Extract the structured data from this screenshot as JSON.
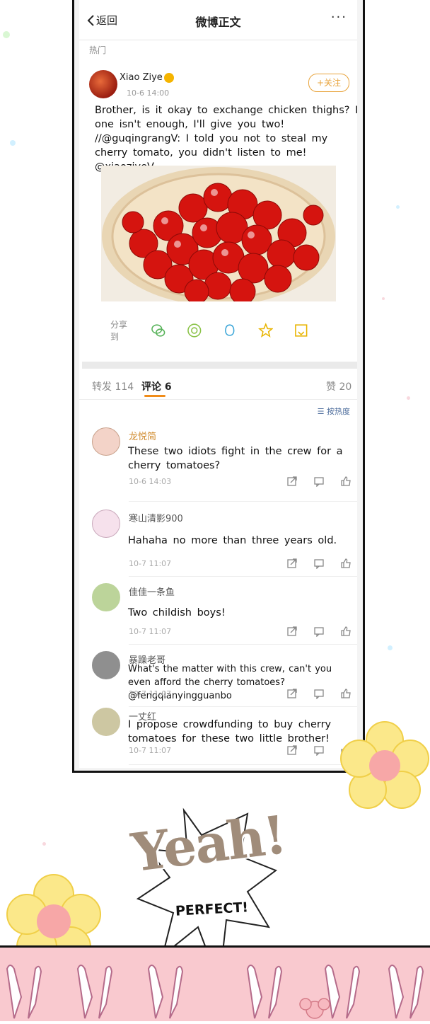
{
  "nav": {
    "back_label": "返回",
    "title": "微博正文",
    "more": "···"
  },
  "section_label": "热门",
  "post": {
    "author": "Xiao Ziye",
    "time": "10-6 14:00",
    "follow_label": "+关注",
    "text": "Brother, is it okay to exchange chicken thighs? If one isn't enough, I'll give you two! //@guqingrangV: I told you not to steal my cherry tomato, you didn't listen to me! @xiaoziyeV",
    "share_label": "分享到",
    "share_icons": [
      "wechat-icon",
      "moments-icon",
      "qq-icon",
      "qzone-icon",
      "save-icon"
    ]
  },
  "tabs": {
    "repost": "转发 114",
    "comments": "评论 6",
    "likes": "赞 20"
  },
  "sort_label": "按热度",
  "comments": [
    {
      "name": "龙悦简",
      "text": "These two idiots fight in the crew for a cherry tomatoes?",
      "time": "10-6 14:03"
    },
    {
      "name": "寒山清影900",
      "text": "Hahaha no more than three years old.",
      "time": "10-7 11:07"
    },
    {
      "name": "佳佳一条鱼",
      "text": "Two childish boys!",
      "time": "10-7 11:07"
    },
    {
      "name": "暴躁老哥",
      "text": "What's the matter with this crew, can't you even afford the cherry tomatoes? @fengqianyingguanbo",
      "time": "10-7 11:07"
    },
    {
      "name": "一丈红",
      "text": "I propose crowdfunding to buy cherry tomatoes for these two little brother!",
      "time": "10-7 11:07"
    }
  ],
  "comic": {
    "yeah": "Yeah!",
    "perfect": "PERFECT!"
  },
  "colors": {
    "accent": "#f08c19",
    "follow": "#e8a33b",
    "link": "#4a6a9a"
  }
}
